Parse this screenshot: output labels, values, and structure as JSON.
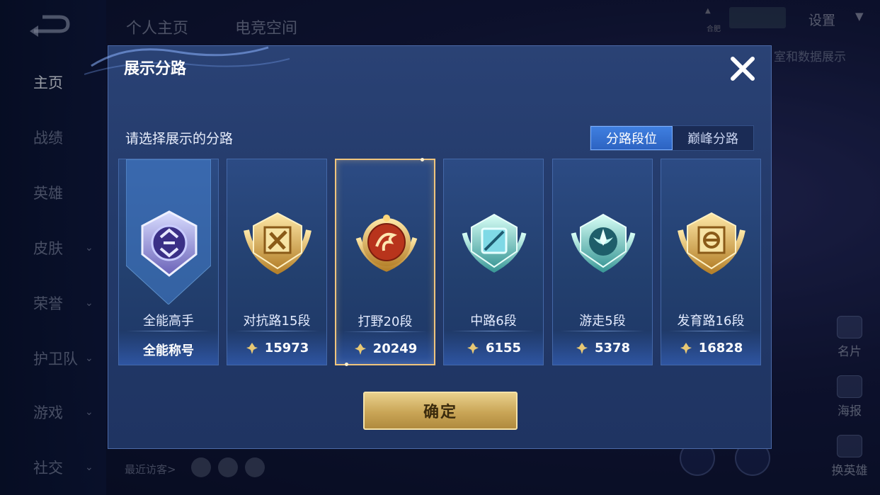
{
  "background": {
    "nav": [
      {
        "label": "主页",
        "active": true,
        "chevron": false
      },
      {
        "label": "战绩",
        "active": false,
        "chevron": false
      },
      {
        "label": "英雄",
        "active": false,
        "chevron": false
      },
      {
        "label": "皮肤",
        "active": false,
        "chevron": true
      },
      {
        "label": "荣誉",
        "active": false,
        "chevron": true
      },
      {
        "label": "护卫队",
        "active": false,
        "chevron": true
      },
      {
        "label": "游戏",
        "active": false,
        "chevron": true
      },
      {
        "label": "社交",
        "active": false,
        "chevron": true
      }
    ],
    "top_tabs": [
      "个人主页",
      "电竞空间"
    ],
    "settings_label": "设置",
    "status_small": "合肥",
    "subtitle": "室和数据展示",
    "right_buttons": [
      "名片",
      "海报",
      "换英雄"
    ],
    "recent_visitors_label": "最近访客>"
  },
  "modal": {
    "title": "展示分路",
    "prompt": "请选择展示的分路",
    "tabs": [
      "分路段位",
      "巅峰分路"
    ],
    "active_tab": 0,
    "cards": [
      {
        "name": "全能高手",
        "score": "全能称号",
        "badge": "allround-badge",
        "has_coin": false,
        "selected": false
      },
      {
        "name": "对抗路15段",
        "score": "15973",
        "badge": "clash-lane-badge",
        "has_coin": true,
        "selected": false
      },
      {
        "name": "打野20段",
        "score": "20249",
        "badge": "jungle-badge",
        "has_coin": true,
        "selected": true
      },
      {
        "name": "中路6段",
        "score": "6155",
        "badge": "mid-lane-badge",
        "has_coin": true,
        "selected": false
      },
      {
        "name": "游走5段",
        "score": "5378",
        "badge": "roam-badge",
        "has_coin": true,
        "selected": false
      },
      {
        "name": "发育路16段",
        "score": "16828",
        "badge": "farm-lane-badge",
        "has_coin": true,
        "selected": false
      }
    ],
    "confirm_label": "确定"
  },
  "colors": {
    "accent_blue": "#3f7fe0",
    "gold": "#d4af5f",
    "selected_border": "#f0c57d"
  }
}
